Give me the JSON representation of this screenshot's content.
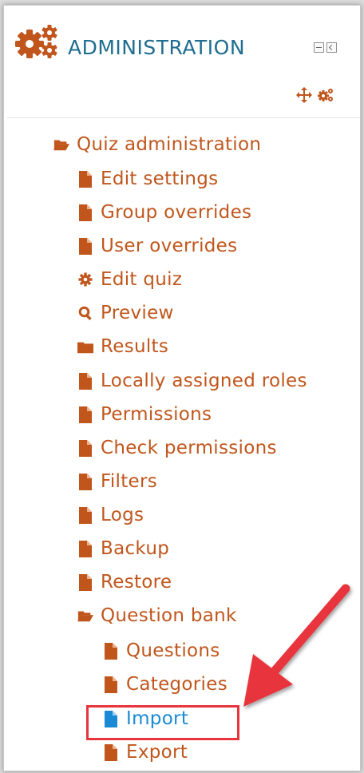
{
  "block": {
    "title": "ADMINISTRATION",
    "colors": {
      "title": "#1f6d8f",
      "link": "#c0561c",
      "selected": "#1a8ad4",
      "highlight": "#e8353d"
    }
  },
  "tree": {
    "root": {
      "label": "Quiz administration",
      "icon": "folder-open-icon"
    },
    "items": [
      {
        "label": "Edit settings",
        "icon": "file-icon"
      },
      {
        "label": "Group overrides",
        "icon": "file-icon"
      },
      {
        "label": "User overrides",
        "icon": "file-icon"
      },
      {
        "label": "Edit quiz",
        "icon": "gear-icon"
      },
      {
        "label": "Preview",
        "icon": "search-icon"
      },
      {
        "label": "Results",
        "icon": "folder-icon"
      },
      {
        "label": "Locally assigned roles",
        "icon": "file-icon"
      },
      {
        "label": "Permissions",
        "icon": "file-icon"
      },
      {
        "label": "Check permissions",
        "icon": "file-icon"
      },
      {
        "label": "Filters",
        "icon": "file-icon"
      },
      {
        "label": "Logs",
        "icon": "file-icon"
      },
      {
        "label": "Backup",
        "icon": "file-icon"
      },
      {
        "label": "Restore",
        "icon": "file-icon"
      }
    ],
    "question_bank": {
      "label": "Question bank",
      "icon": "folder-open-icon",
      "children": [
        {
          "label": "Questions",
          "icon": "file-icon"
        },
        {
          "label": "Categories",
          "icon": "file-icon"
        },
        {
          "label": "Import",
          "icon": "file-icon",
          "selected": true
        },
        {
          "label": "Export",
          "icon": "file-icon"
        }
      ]
    }
  }
}
